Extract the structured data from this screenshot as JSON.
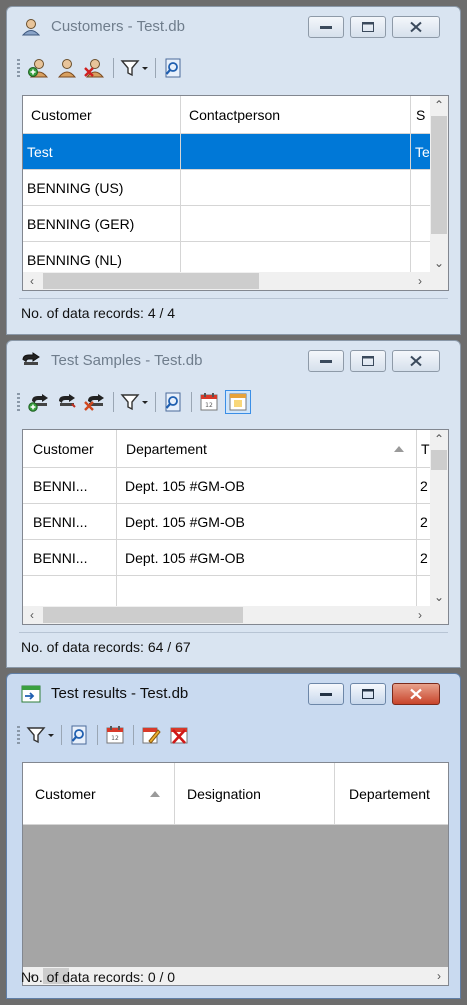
{
  "windows": [
    {
      "title": "Customers - Test.db",
      "icon": "customer-icon",
      "toolbar": [
        "add-customer-icon",
        "edit-customer-icon",
        "delete-customer-icon",
        "filter-dropdown-icon",
        "search-icon"
      ],
      "columns": [
        "Customer",
        "Contactperson",
        "S"
      ],
      "rows": [
        [
          "Test",
          "",
          "Te"
        ],
        [
          "BENNING (US)",
          "",
          ""
        ],
        [
          "BENNING (GER)",
          "",
          ""
        ],
        [
          "BENNING (NL)",
          "",
          ""
        ]
      ],
      "selected_row": 0,
      "status": "No. of data records: 4 / 4"
    },
    {
      "title": "Test Samples - Test.db",
      "icon": "test-sample-icon",
      "toolbar": [
        "add-sample-icon",
        "edit-sample-icon",
        "delete-sample-icon",
        "filter-dropdown-icon",
        "search-icon",
        "calendar-icon",
        "calendar-view-icon"
      ],
      "columns": [
        "Customer",
        "Departement",
        "T"
      ],
      "sorted_column": "Departement",
      "rows": [
        [
          "BENNI...",
          "Dept. 105 #GM-OB",
          "2"
        ],
        [
          "BENNI...",
          "Dept. 105 #GM-OB",
          "2"
        ],
        [
          "BENNI...",
          "Dept. 105 #GM-OB",
          "2"
        ]
      ],
      "status": "No. of data records: 64 / 67"
    },
    {
      "title": "Test results - Test.db",
      "icon": "test-results-icon",
      "toolbar": [
        "filter-dropdown-icon",
        "search-icon",
        "calendar-icon",
        "edit-report-icon",
        "delete-report-icon"
      ],
      "columns": [
        "Customer",
        "Designation",
        "Departement"
      ],
      "sorted_column": "Customer",
      "rows": [],
      "status": "No. of data records: 0 / 0"
    }
  ],
  "colors": {
    "selection": "#0078d7",
    "close_button_active": "#c8442b",
    "workspace": "#6d6d6d"
  }
}
